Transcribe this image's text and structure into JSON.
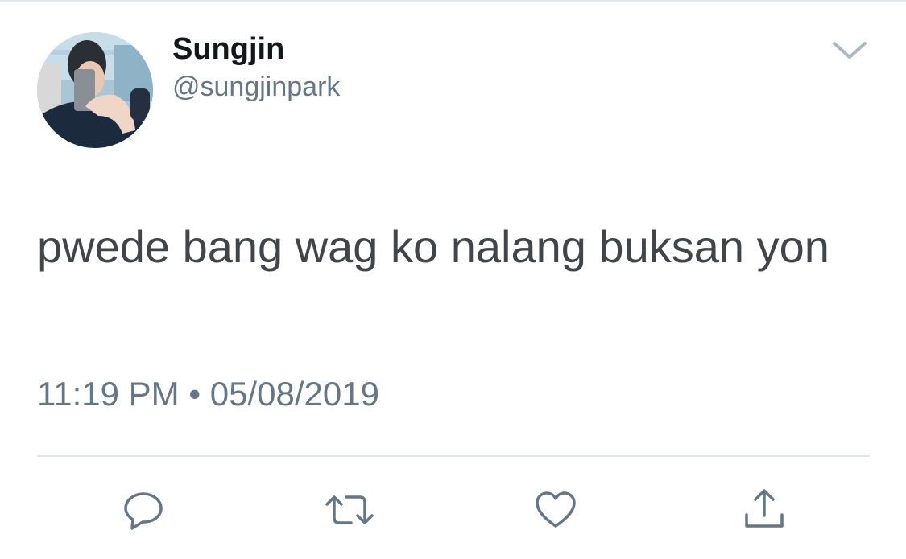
{
  "tweet": {
    "author": {
      "display_name": "Sungjin",
      "handle": "@sungjinpark"
    },
    "text": "pwede bang wag ko nalang buksan yon",
    "time": "11:19 PM",
    "separator": "•",
    "date": "05/08/2019"
  },
  "icons": {
    "menu": "chevron-down-icon",
    "reply": "reply-icon",
    "retweet": "retweet-icon",
    "like": "heart-icon",
    "share": "share-icon"
  },
  "colors": {
    "name": "#14171a",
    "secondary": "#657786",
    "body": "#414448",
    "divider": "#e1e8ed"
  }
}
